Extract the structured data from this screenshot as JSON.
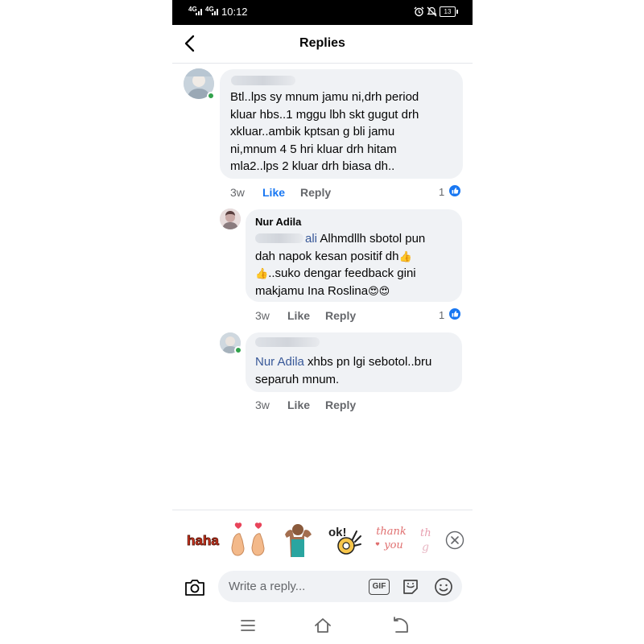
{
  "status_bar": {
    "network_1": "4G",
    "network_2": "4G",
    "time": "10:12",
    "battery": "13"
  },
  "header": {
    "title": "Replies"
  },
  "comments": [
    {
      "lines": [
        "Btl..lps sy mnum jamu ni,drh period",
        "kluar hbs..1 mggu lbh skt gugut drh",
        "xkluar..ambik kptsan g bli jamu",
        "ni,mnum 4 5 hri kluar drh hitam",
        "mla2..lps 2 kluar drh biasa dh.."
      ],
      "time": "3w",
      "like": "Like",
      "reply": "Reply",
      "reactions": "1"
    },
    {
      "author": "Nur Adila",
      "tag_fragment": "ali",
      "line1_rest": " Alhmdllh sbotol pun",
      "line2": "dah napok kesan positif dh",
      "line3": "..suko dengar feedback gini",
      "line4": "makjamu Ina Roslina",
      "emoji_thumb": "👍",
      "emoji_love": "😍😍",
      "time": "3w",
      "like": "Like",
      "reply": "Reply",
      "reactions": "1"
    },
    {
      "tag": "Nur Adila",
      "line1_rest": " xhbs pn lgi sebotol..bru",
      "line2": "separuh mnum.",
      "time": "3w",
      "like": "Like",
      "reply": "Reply"
    }
  ],
  "sticker_tray": {
    "stickers": [
      "haha-sticker",
      "finger-heart-sticker",
      "muscle-woman-sticker",
      "ok-sticker",
      "thank-you-sticker",
      "partial-sticker"
    ]
  },
  "composer": {
    "placeholder": "Write a reply...",
    "gif_label": "GIF"
  },
  "colors": {
    "accent": "#1877f2",
    "bubble": "#f0f2f5",
    "meta": "#65676b",
    "tag": "#385898",
    "online": "#31a24c"
  }
}
